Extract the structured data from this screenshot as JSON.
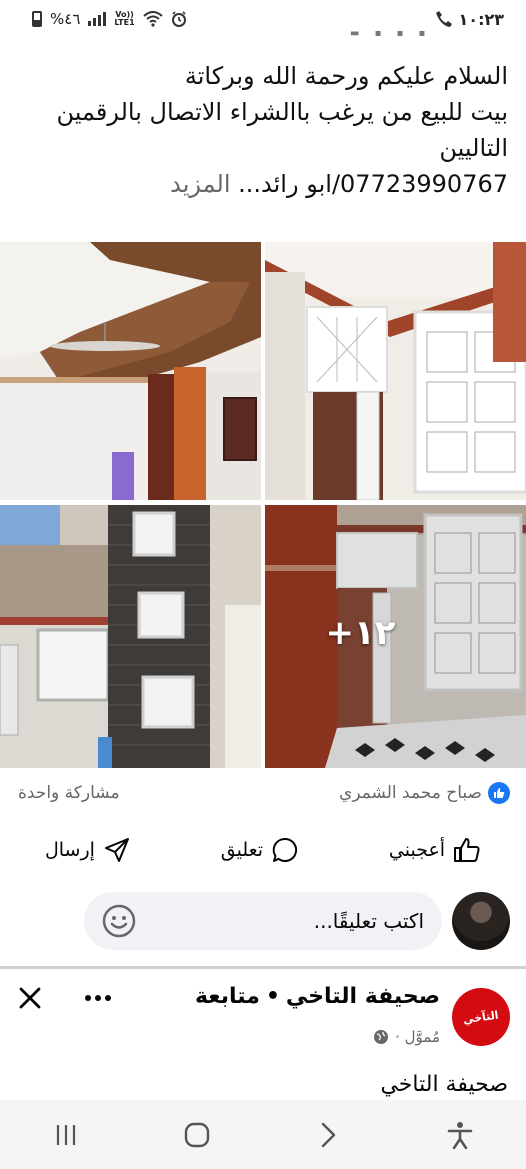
{
  "status_bar": {
    "time": "١٠:٢٣",
    "battery": "%٤٦",
    "network_label_top": "Vo))",
    "network_label_bottom": "LTE1"
  },
  "post": {
    "text_lines": [
      "السلام عليكم ورحمة الله وبركاتة",
      "بيت للبيع من يرغب باالشراء الاتصال بالرقمين",
      "التاليين",
      "07723990767/ابو رائد..."
    ],
    "see_more": "المزيد",
    "photos_more_count": "+١٢"
  },
  "reactions": {
    "reactor_name": "صباح محمد الشمري",
    "shares": "مشاركة واحدة"
  },
  "actions": {
    "like": "أعجبني",
    "comment": "تعليق",
    "send": "إرسال"
  },
  "composer": {
    "placeholder": "اكتب تعليقًا..."
  },
  "next_post": {
    "page_name": "صحيفة التاخي",
    "separator": "•",
    "follow": "متابعة",
    "sponsored": "مُموَّل ·",
    "snippet": "صحيفة التاخي",
    "logo_text": "التآخي"
  },
  "colors": {
    "facebook_blue": "#1877f2",
    "logo_red": "#d40c12",
    "muted_text": "#65676b",
    "composer_bg": "#f0f2f5"
  }
}
